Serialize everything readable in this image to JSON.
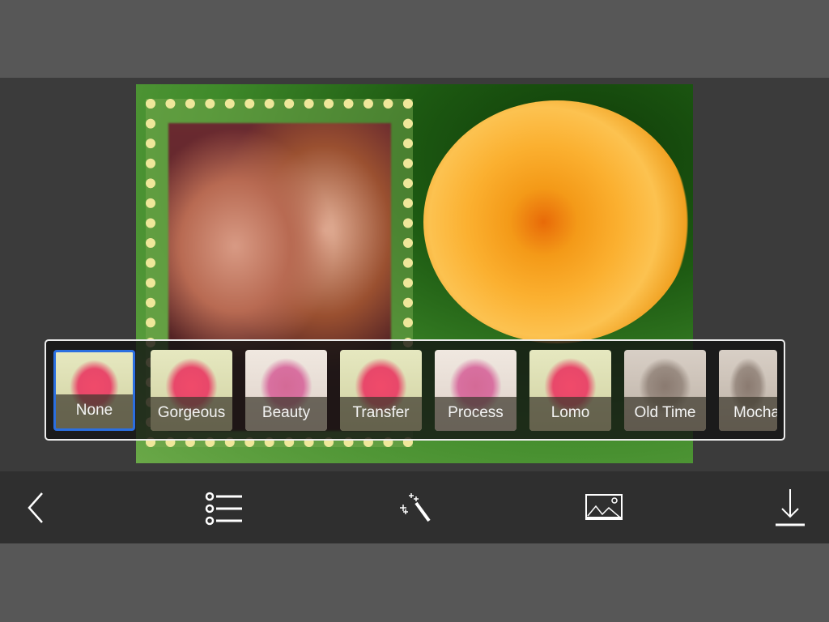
{
  "filters": [
    {
      "label": "None",
      "selected": true
    },
    {
      "label": "Gorgeous"
    },
    {
      "label": "Beauty"
    },
    {
      "label": "Transfer"
    },
    {
      "label": "Process"
    },
    {
      "label": "Lomo"
    },
    {
      "label": "Old Time"
    },
    {
      "label": "Mocha"
    }
  ],
  "toolbar": {
    "icons": [
      "back-chevron-icon",
      "list-icon",
      "magic-wand-icon",
      "image-icon",
      "download-icon"
    ]
  },
  "colors": {
    "selected": "#2b6fe0",
    "toolbar": "#2f2f2f"
  }
}
